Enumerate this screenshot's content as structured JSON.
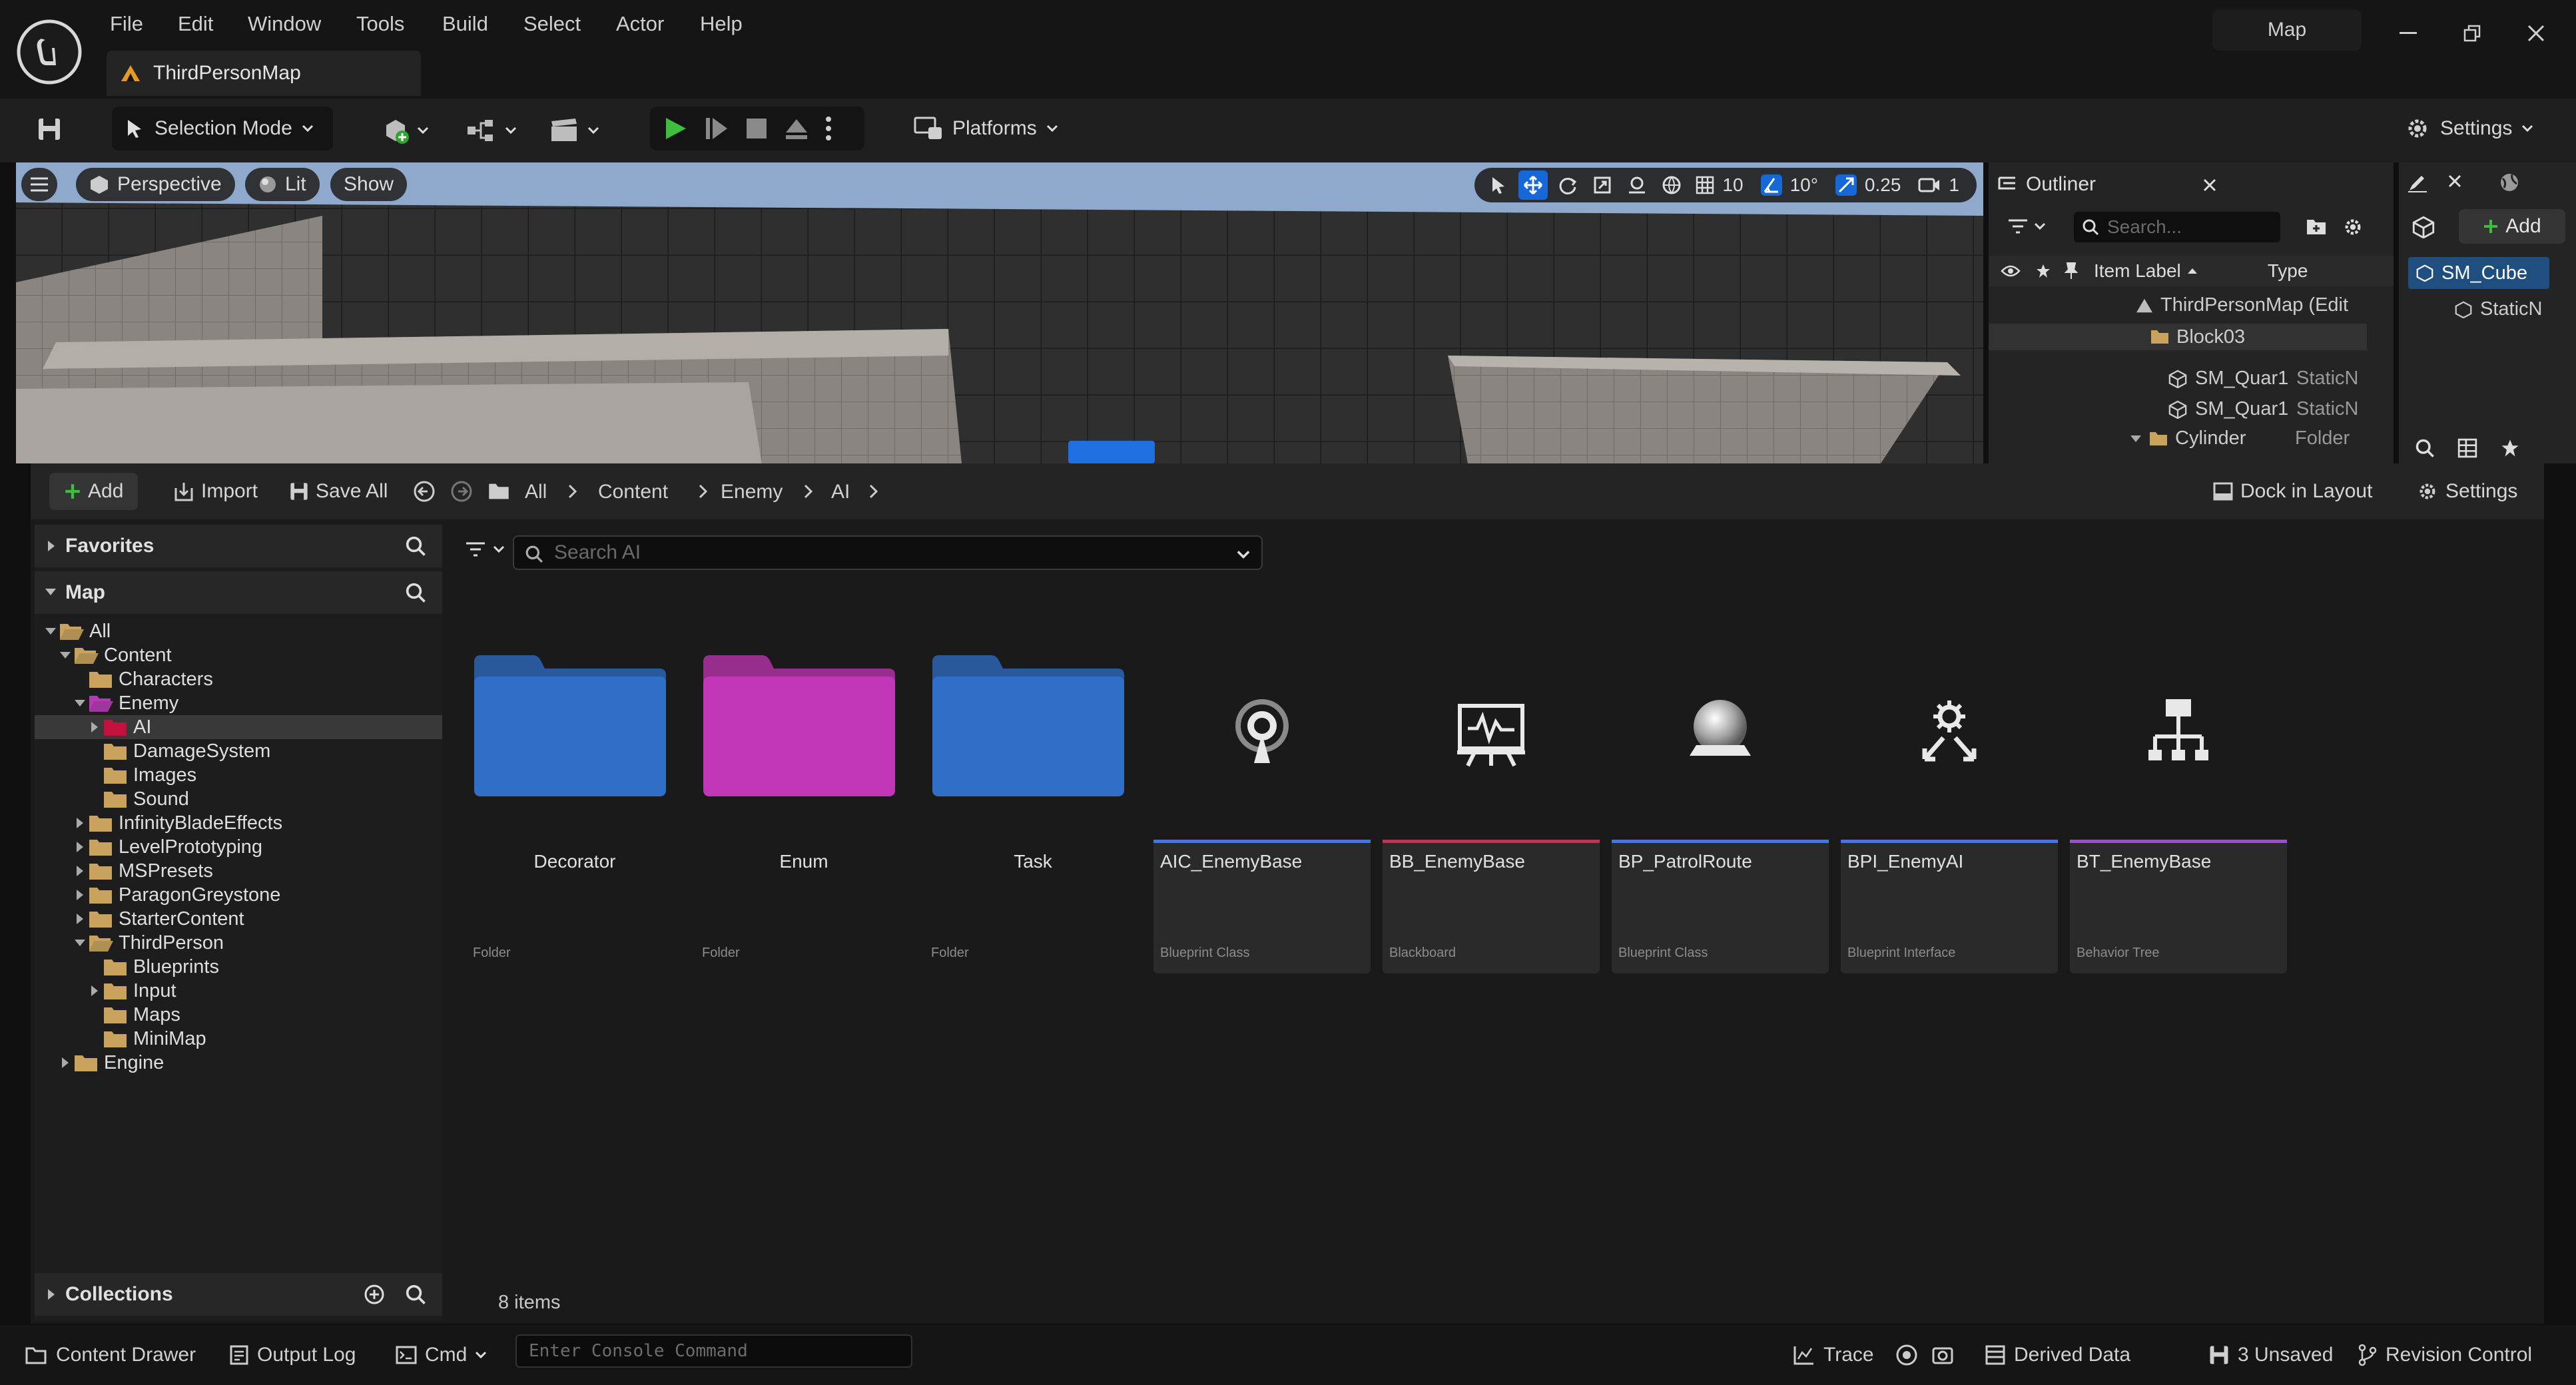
{
  "menu": [
    "File",
    "Edit",
    "Window",
    "Tools",
    "Build",
    "Select",
    "Actor",
    "Help"
  ],
  "title_chip": "Map",
  "document_tab": "ThirdPersonMap",
  "toolbar": {
    "selection_mode": "Selection Mode",
    "platforms": "Platforms",
    "settings": "Settings"
  },
  "viewport": {
    "perspective": "Perspective",
    "lit": "Lit",
    "show": "Show",
    "grid_snap": "10",
    "rotate_snap": "10°",
    "scale_snap": "0.25",
    "camera_speed": "1"
  },
  "outliner": {
    "title": "Outliner",
    "search_placeholder": "Search...",
    "col_label": "Item Label",
    "col_type": "Type",
    "rows": [
      {
        "label": "ThirdPersonMap (Edit",
        "type": ""
      },
      {
        "label": "Block03",
        "type": ""
      },
      {
        "label": "SM_Quar1",
        "type": "StaticN"
      },
      {
        "label": "SM_Quar1",
        "type": "StaticN"
      },
      {
        "label": "Cylinder",
        "type": "Folder"
      }
    ]
  },
  "details": {
    "add": "Add",
    "selected": "SM_Cube",
    "component": "StaticN"
  },
  "drawer": {
    "add": "Add",
    "import": "Import",
    "save_all": "Save All",
    "breadcrumbs": [
      "All",
      "Content",
      "Enemy",
      "AI"
    ],
    "dock": "Dock in Layout",
    "settings": "Settings",
    "favorites": "Favorites",
    "map": "Map",
    "collections": "Collections",
    "search_placeholder": "Search AI",
    "item_count": "8 items",
    "tree": [
      {
        "label": "All",
        "depth": 0,
        "arrow": "down",
        "color": "#c9a35e",
        "open": true
      },
      {
        "label": "Content",
        "depth": 1,
        "arrow": "down",
        "color": "#c9a35e",
        "open": true
      },
      {
        "label": "Characters",
        "depth": 2,
        "arrow": "",
        "color": "#c9a35e"
      },
      {
        "label": "Enemy",
        "depth": 2,
        "arrow": "down",
        "color": "#b43bb4",
        "open": true
      },
      {
        "label": "AI",
        "depth": 3,
        "arrow": "right",
        "color": "#c4103c",
        "selected": true
      },
      {
        "label": "DamageSystem",
        "depth": 3,
        "arrow": "",
        "color": "#c9a35e"
      },
      {
        "label": "Images",
        "depth": 3,
        "arrow": "",
        "color": "#c9a35e"
      },
      {
        "label": "Sound",
        "depth": 3,
        "arrow": "",
        "color": "#c9a35e"
      },
      {
        "label": "InfinityBladeEffects",
        "depth": 2,
        "arrow": "right",
        "color": "#c9a35e"
      },
      {
        "label": "LevelPrototyping",
        "depth": 2,
        "arrow": "right",
        "color": "#c9a35e"
      },
      {
        "label": "MSPresets",
        "depth": 2,
        "arrow": "right",
        "color": "#c9a35e"
      },
      {
        "label": "ParagonGreystone",
        "depth": 2,
        "arrow": "right",
        "color": "#c9a35e"
      },
      {
        "label": "StarterContent",
        "depth": 2,
        "arrow": "right",
        "color": "#c9a35e"
      },
      {
        "label": "ThirdPerson",
        "depth": 2,
        "arrow": "down",
        "color": "#c9a35e",
        "open": true
      },
      {
        "label": "Blueprints",
        "depth": 3,
        "arrow": "",
        "color": "#c9a35e"
      },
      {
        "label": "Input",
        "depth": 3,
        "arrow": "right",
        "color": "#c9a35e"
      },
      {
        "label": "Maps",
        "depth": 3,
        "arrow": "",
        "color": "#c9a35e"
      },
      {
        "label": "MiniMap",
        "depth": 3,
        "arrow": "",
        "color": "#c9a35e"
      },
      {
        "label": "Engine",
        "depth": 1,
        "arrow": "right",
        "color": "#c9a35e"
      }
    ],
    "assets": [
      {
        "name": "Decorator",
        "type": "Folder",
        "kind": "folder",
        "color": "#2f6fc7"
      },
      {
        "name": "Enum",
        "type": "Folder",
        "kind": "folder",
        "color": "#c136b6"
      },
      {
        "name": "Task",
        "type": "Folder",
        "kind": "folder",
        "color": "#2f6fc7"
      },
      {
        "name": "AIC_EnemyBase",
        "type": "Blueprint Class",
        "kind": "asset",
        "icon": "ai-controller-icon",
        "stripe": "#3f74ff"
      },
      {
        "name": "BB_EnemyBase",
        "type": "Blackboard",
        "kind": "asset",
        "icon": "blackboard-icon",
        "stripe": "#d42a55"
      },
      {
        "name": "BP_PatrolRoute",
        "type": "Blueprint Class",
        "kind": "asset",
        "icon": "sphere-icon",
        "stripe": "#3f74ff"
      },
      {
        "name": "BPI_EnemyAI",
        "type": "Blueprint Interface",
        "kind": "asset",
        "icon": "interface-icon",
        "stripe": "#3f74ff"
      },
      {
        "name": "BT_EnemyBase",
        "type": "Behavior Tree",
        "kind": "asset",
        "icon": "behavior-tree-icon",
        "stripe": "#9b4dde"
      }
    ]
  },
  "statusbar": {
    "content_drawer": "Content Drawer",
    "output_log": "Output Log",
    "cmd": "Cmd",
    "console_placeholder": "Enter Console Command",
    "trace": "Trace",
    "derived_data": "Derived Data",
    "unsaved": "3 Unsaved",
    "revision_control": "Revision Control"
  }
}
